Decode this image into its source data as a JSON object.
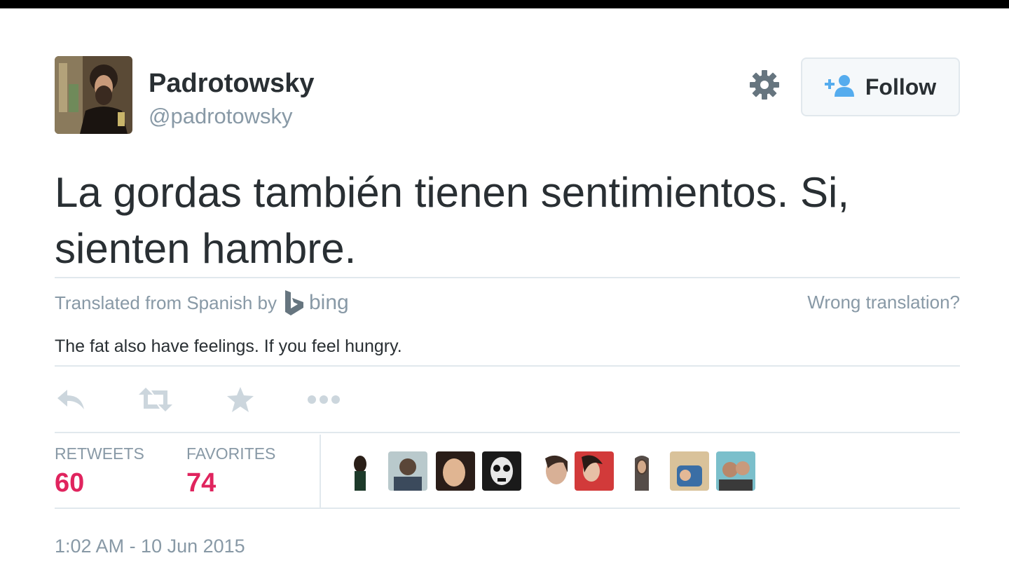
{
  "user": {
    "display_name": "Padrotowsky",
    "handle": "@padrotowsky",
    "avatar_icon": "user-avatar"
  },
  "header_actions": {
    "settings_icon": "gear-icon",
    "follow_label": "Follow",
    "follow_icon": "add-user-icon"
  },
  "tweet": {
    "text": "La gordas también tienen sentimientos. Si, sienten hambre."
  },
  "translation": {
    "prefix": "Translated from Spanish by",
    "provider": "bing",
    "wrong_link": "Wrong translation?",
    "text": "The fat also have feelings. If you feel hungry."
  },
  "actions": [
    {
      "name": "reply",
      "icon": "reply-icon"
    },
    {
      "name": "retweet",
      "icon": "retweet-icon"
    },
    {
      "name": "favorite",
      "icon": "star-icon"
    },
    {
      "name": "more",
      "icon": "more-dots-icon"
    }
  ],
  "stats": {
    "retweets_label": "RETWEETS",
    "retweets_count": "60",
    "favorites_label": "FAVORITES",
    "favorites_count": "74"
  },
  "favoriters": [
    {
      "avatar": "avatar-1"
    },
    {
      "avatar": "avatar-2"
    },
    {
      "avatar": "avatar-3"
    },
    {
      "avatar": "avatar-4"
    },
    {
      "avatar": "avatar-5"
    },
    {
      "avatar": "avatar-6"
    },
    {
      "avatar": "avatar-7"
    },
    {
      "avatar": "avatar-8"
    },
    {
      "avatar": "avatar-9"
    }
  ],
  "timestamp": "1:02 AM - 10 Jun 2015",
  "colors": {
    "accent_blue": "#55acee",
    "count_red": "#e0245e",
    "muted_gray": "#8899a6",
    "text_dark": "#292f33"
  }
}
